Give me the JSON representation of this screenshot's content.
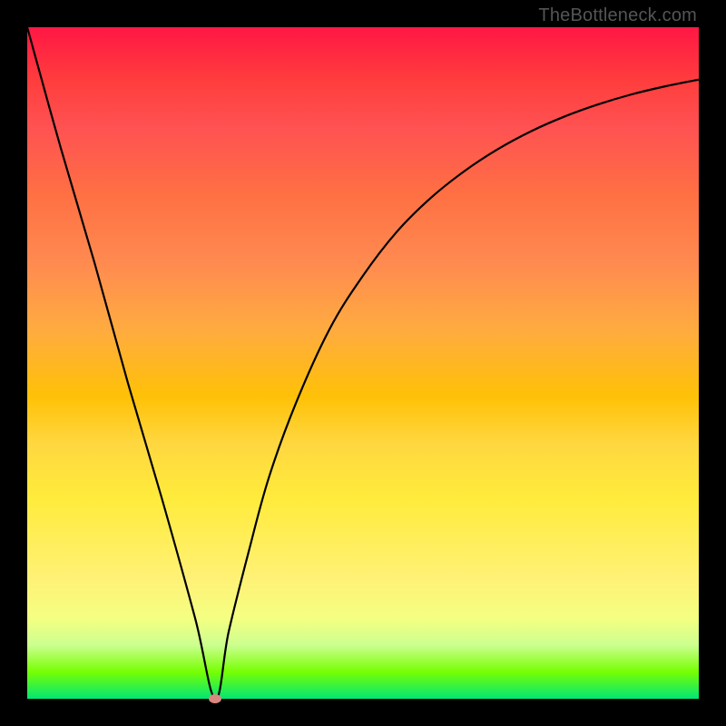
{
  "watermark": "TheBottleneck.com",
  "chart_data": {
    "type": "line",
    "title": "",
    "xlabel": "",
    "ylabel": "",
    "xlim": [
      0,
      100
    ],
    "ylim": [
      0,
      100
    ],
    "background_gradient": {
      "top_color": "#ff1744",
      "bottom_color": "#00e676"
    },
    "marker": {
      "x": 28,
      "y": 0,
      "color": "#d98880"
    },
    "series": [
      {
        "name": "curve",
        "x": [
          0,
          5,
          10,
          15,
          20,
          25,
          28,
          30,
          33,
          36,
          40,
          45,
          50,
          55,
          60,
          65,
          70,
          75,
          80,
          85,
          90,
          95,
          100
        ],
        "values": [
          100,
          82,
          65,
          47,
          30,
          12,
          0,
          10,
          22,
          33,
          44,
          55,
          63,
          69.5,
          74.5,
          78.5,
          81.8,
          84.5,
          86.7,
          88.5,
          90,
          91.2,
          92.2
        ]
      }
    ]
  }
}
